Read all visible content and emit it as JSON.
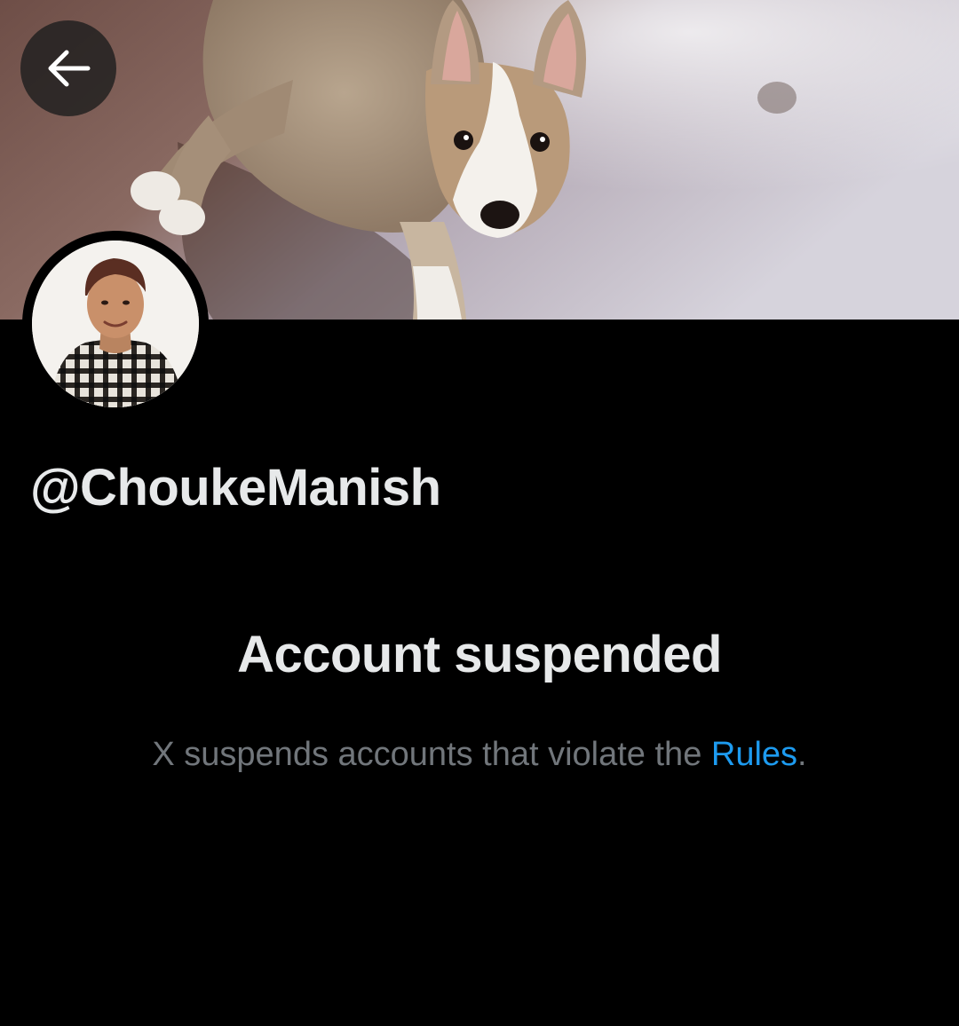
{
  "profile": {
    "handle": "@ChoukeManish",
    "banner_image": "puppy-on-floor-photo",
    "avatar_image": "profile-photo"
  },
  "nav": {
    "back_icon": "arrow-left-icon"
  },
  "suspension": {
    "title": "Account suspended",
    "message_prefix": "X suspends accounts that violate the ",
    "rules_link": "Rules",
    "message_suffix": "."
  },
  "colors": {
    "background": "#000000",
    "primary_text": "#e7e9ea",
    "secondary_text": "#71767b",
    "link": "#1d9bf0"
  }
}
